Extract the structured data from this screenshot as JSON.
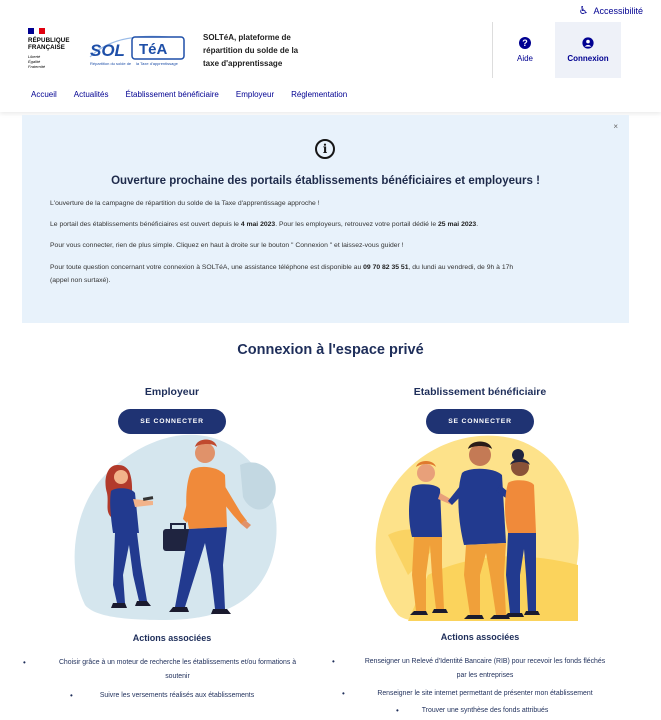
{
  "header": {
    "accessibility_label": "Accessibilité",
    "republic_lines": [
      "RÉPUBLIQUE",
      "FRANÇAISE"
    ],
    "motto_lines": [
      "Liberté",
      "Égalité",
      "Fraternité"
    ],
    "logo": {
      "sol": "SOL",
      "tea": "TéA",
      "sub_left": "Répartition du solde de",
      "sub_right": "la Taxe d'apprentissage"
    },
    "tagline": "SOLTéA, plateforme de répartition du solde de la taxe d'apprentissage",
    "help_label": "Aide",
    "login_label": "Connexion",
    "nav": [
      "Accueil",
      "Actualités",
      "Établissement bénéficiaire",
      "Employeur",
      "Réglementation"
    ]
  },
  "alert": {
    "close_label": "×",
    "title": "Ouverture prochaine des portails établissements bénéficiaires et employeurs !",
    "p1": "L'ouverture de la campagne de répartition du solde de la Taxe d'apprentissage approche !",
    "p2_a": "Le portail des établissements bénéficiaires est ouvert depuis le ",
    "p2_b": "4 mai 2023",
    "p2_c": ". Pour les employeurs, retrouvez votre portail dédié le ",
    "p2_d": "25 mai 2023",
    "p2_e": ".",
    "p3": "Pour vous connecter, rien de plus simple. Cliquez en haut à droite sur le bouton \" Connexion \" et laissez-vous guider !",
    "p4_a": "Pour toute question concernant votre connexion à SOLTéA, une assistance téléphone est disponible au ",
    "p4_b": "09 70 82 35 51",
    "p4_c": ", du lundi au vendredi, de 9h à 17h",
    "p4_d": "(appel non surtaxé)."
  },
  "section": {
    "title": "Connexion à l'espace privé",
    "employer": {
      "title": "Employeur",
      "button": "SE CONNECTER",
      "actions_title": "Actions associées",
      "actions": [
        [
          "Choisir grâce à un moteur de recherche les établissements et/ou formations à",
          "soutenir"
        ],
        [
          "Suivre les versements réalisés aux établissements"
        ]
      ]
    },
    "beneficiary": {
      "title": "Etablissement bénéficiaire",
      "button": "SE CONNECTER",
      "actions_title": "Actions associées",
      "actions": [
        [
          "Renseigner un Relevé d'Identité Bancaire (RIB) pour recevoir les fonds fléchés",
          "par les entreprises"
        ],
        [
          "Renseigner le site internet permettant de présenter mon établissement"
        ],
        [
          "Trouver une synthèse des fonds attribués"
        ]
      ]
    }
  },
  "colors": {
    "primary": "#000091",
    "navy": "#1f3373",
    "alert_bg": "#e8f2fb",
    "flag_blue": "#000091",
    "flag_red": "#e1000f"
  }
}
